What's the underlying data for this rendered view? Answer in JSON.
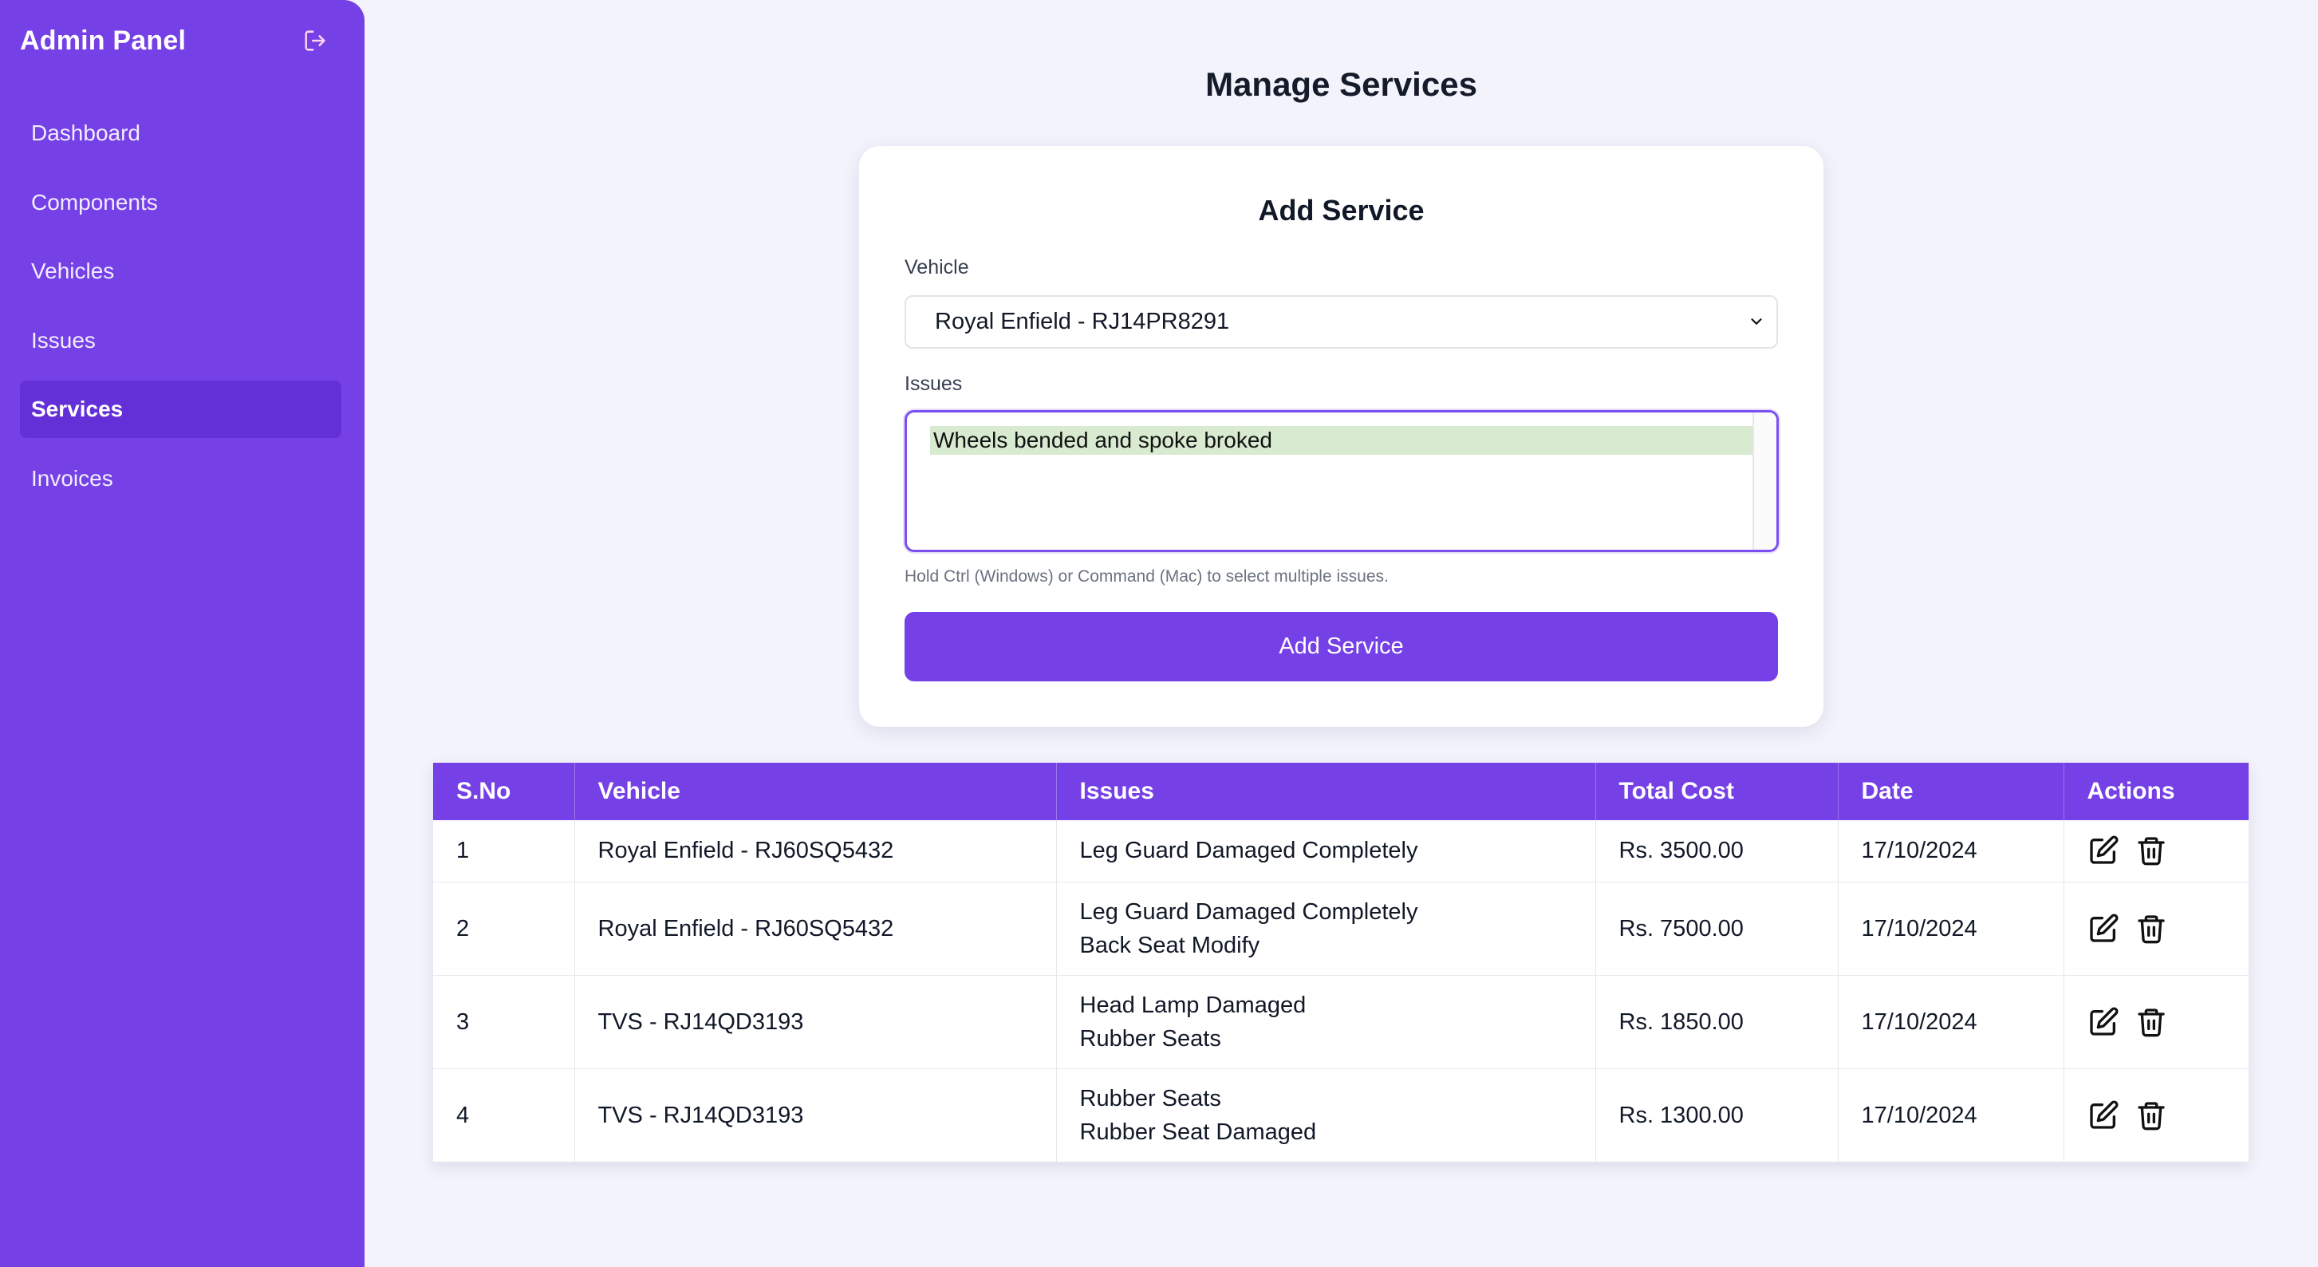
{
  "sidebar": {
    "title": "Admin Panel",
    "logout_icon": "logout-icon",
    "items": [
      {
        "label": "Dashboard",
        "active": false
      },
      {
        "label": "Components",
        "active": false
      },
      {
        "label": "Vehicles",
        "active": false
      },
      {
        "label": "Issues",
        "active": false
      },
      {
        "label": "Services",
        "active": true
      },
      {
        "label": "Invoices",
        "active": false
      }
    ]
  },
  "page": {
    "title": "Manage Services"
  },
  "form": {
    "title": "Add Service",
    "vehicle_label": "Vehicle",
    "vehicle_selected": "Royal Enfield - RJ14PR8291",
    "issues_label": "Issues",
    "issues_options": [
      "Wheels bended and spoke broked"
    ],
    "issues_selected": [
      "Wheels bended and spoke broked"
    ],
    "hint": "Hold Ctrl (Windows) or Command (Mac) to select multiple issues.",
    "submit_label": "Add Service"
  },
  "table": {
    "headers": [
      "S.No",
      "Vehicle",
      "Issues",
      "Total Cost",
      "Date",
      "Actions"
    ],
    "rows": [
      {
        "sno": "1",
        "vehicle": "Royal Enfield - RJ60SQ5432",
        "issues": [
          "Leg Guard Damaged Completely"
        ],
        "cost": "Rs. 3500.00",
        "date": "17/10/2024"
      },
      {
        "sno": "2",
        "vehicle": "Royal Enfield - RJ60SQ5432",
        "issues": [
          "Leg Guard Damaged Completely",
          "Back Seat Modify"
        ],
        "cost": "Rs. 7500.00",
        "date": "17/10/2024"
      },
      {
        "sno": "3",
        "vehicle": "TVS - RJ14QD3193",
        "issues": [
          "Head Lamp Damaged",
          "Rubber Seats"
        ],
        "cost": "Rs. 1850.00",
        "date": "17/10/2024"
      },
      {
        "sno": "4",
        "vehicle": "TVS - RJ14QD3193",
        "issues": [
          "Rubber Seats",
          "Rubber Seat Damaged"
        ],
        "cost": "Rs. 1300.00",
        "date": "17/10/2024"
      }
    ],
    "action_icons": [
      "edit-icon",
      "trash-icon"
    ]
  },
  "colors": {
    "accent": "#7540e6",
    "accent_active": "#6330d8",
    "background": "#f2f3fb",
    "selected_option": "#d8ead0"
  }
}
